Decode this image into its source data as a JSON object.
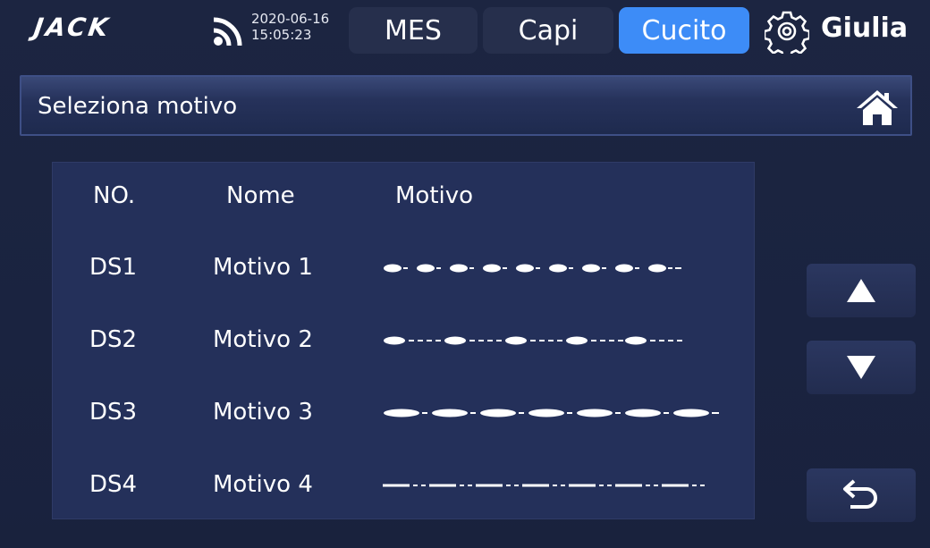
{
  "header": {
    "logo": "JACK",
    "date": "2020-06-16",
    "time": "15:05:23",
    "tabs": [
      {
        "label": "MES",
        "active": false
      },
      {
        "label": "Capi",
        "active": false
      },
      {
        "label": "Cucito",
        "active": true
      }
    ],
    "user": "Giulia"
  },
  "title_bar": {
    "title": "Seleziona motivo",
    "home_icon": "home-icon"
  },
  "table": {
    "columns": [
      "NO.",
      "Nome",
      "Motivo"
    ],
    "rows": [
      {
        "no": "DS1",
        "name": "Motivo 1",
        "pattern": "short-dots"
      },
      {
        "no": "DS2",
        "name": "Motivo 2",
        "pattern": "dot-long-dash"
      },
      {
        "no": "DS3",
        "name": "Motivo 3",
        "pattern": "long-dots"
      },
      {
        "no": "DS4",
        "name": "Motivo 4",
        "pattern": "dash-dot-line"
      }
    ]
  },
  "side_buttons": [
    "up-arrow-icon",
    "down-arrow-icon",
    "back-arrow-icon"
  ],
  "colors": {
    "background": "#1b2440",
    "accent": "#3d8cf7",
    "panel": "#24305a"
  }
}
